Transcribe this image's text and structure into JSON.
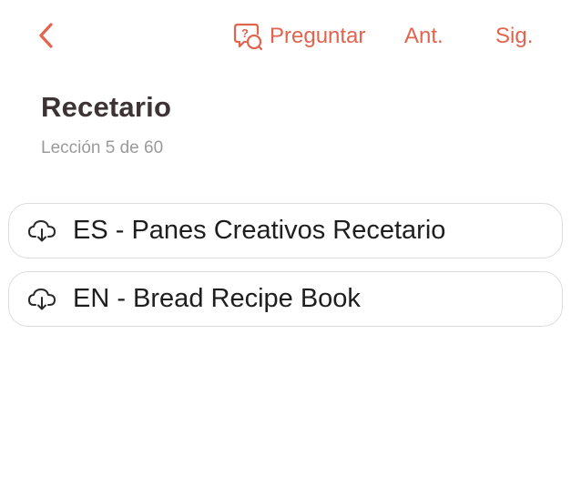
{
  "header": {
    "back_icon": "chevron-left-icon",
    "ask_icon": "question-chat-icon",
    "ask_label": "Preguntar",
    "prev_label": "Ant.",
    "next_label": "Sig.",
    "accent_color": "#e1644e"
  },
  "lesson": {
    "title": "Recetario",
    "subtitle": "Lección 5 de 60"
  },
  "files": [
    {
      "icon": "cloud-download-icon",
      "label": "ES - Panes Creativos Recetario"
    },
    {
      "icon": "cloud-download-icon",
      "label": "EN - Bread Recipe Book"
    }
  ]
}
